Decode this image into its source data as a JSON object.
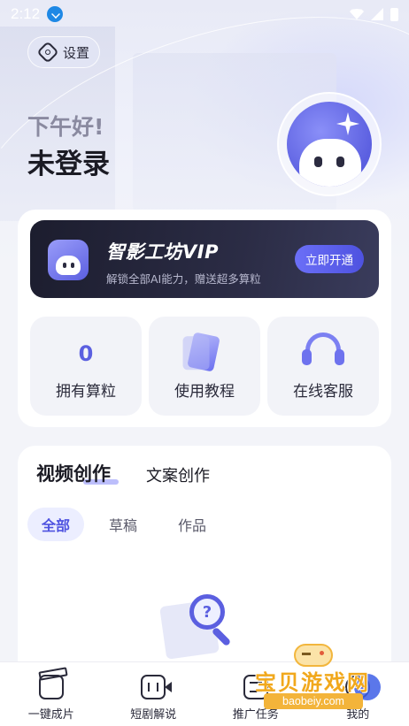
{
  "status_bar": {
    "time": "2:12"
  },
  "header": {
    "settings_label": "设置",
    "greeting": "下午好!",
    "username": "未登录"
  },
  "vip": {
    "title": "智影工坊VIP",
    "description": "解锁全部AI能力，赠送超多算粒",
    "open_button": "立即开通"
  },
  "quick_actions": [
    {
      "value": "0",
      "label": "拥有算粒"
    },
    {
      "label": "使用教程",
      "icon": "book-icon"
    },
    {
      "label": "在线客服",
      "icon": "headset-icon"
    }
  ],
  "creation": {
    "tabs": [
      "视频创作",
      "文案创作"
    ],
    "active_tab": "视频创作",
    "filters": [
      "全部",
      "草稿",
      "作品"
    ],
    "active_filter": "全部"
  },
  "bottom_nav": [
    {
      "label": "一键成片",
      "icon": "clapper-icon"
    },
    {
      "label": "短剧解说",
      "icon": "video-camera-icon"
    },
    {
      "label": "推广任务",
      "icon": "promo-icon"
    },
    {
      "label": "我的",
      "icon": "user-icon"
    }
  ],
  "watermark": {
    "title": "宝贝游戏网",
    "domain": "baobeiy.com"
  },
  "colors": {
    "accent": "#5b5fe0",
    "vip_bg": "#1c1d2e",
    "page_bg": "#f3f4f9"
  }
}
